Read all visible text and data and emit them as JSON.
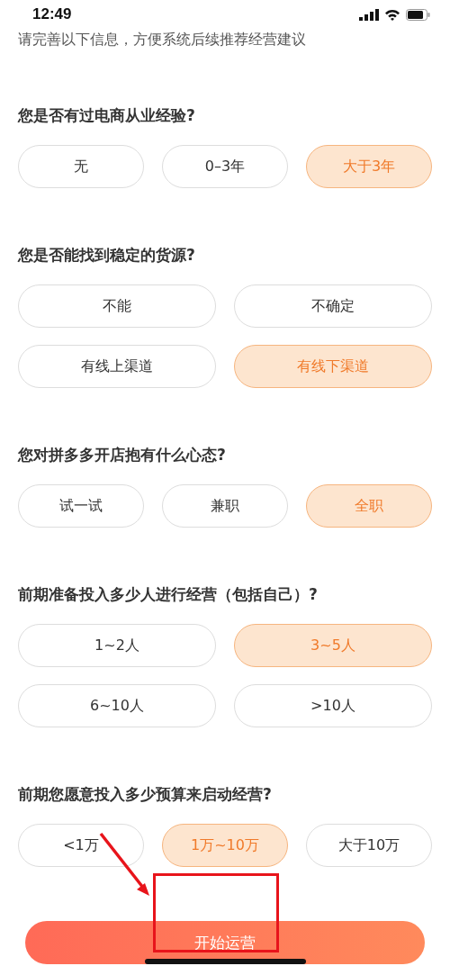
{
  "status_bar": {
    "time": "12:49"
  },
  "intro": "请完善以下信息，方便系统后续推荐经营建议",
  "questions": [
    {
      "title": "您是否有过电商从业经验?",
      "kind": "three",
      "options": [
        {
          "label": "无",
          "selected": false
        },
        {
          "label": "0–3年",
          "selected": false
        },
        {
          "label": "大于3年",
          "selected": true
        }
      ]
    },
    {
      "title": "您是否能找到稳定的货源?",
      "kind": "two",
      "options": [
        {
          "label": "不能",
          "selected": false
        },
        {
          "label": "不确定",
          "selected": false
        },
        {
          "label": "有线上渠道",
          "selected": false
        },
        {
          "label": "有线下渠道",
          "selected": true
        }
      ]
    },
    {
      "title": "您对拼多多开店抱有什么心态?",
      "kind": "three",
      "options": [
        {
          "label": "试一试",
          "selected": false
        },
        {
          "label": "兼职",
          "selected": false
        },
        {
          "label": "全职",
          "selected": true
        }
      ]
    },
    {
      "title": "前期准备投入多少人进行经营（包括自己）?",
      "kind": "two",
      "options": [
        {
          "label": "1~2人",
          "selected": false
        },
        {
          "label": "3~5人",
          "selected": true
        },
        {
          "label": "6~10人",
          "selected": false
        },
        {
          "label": ">10人",
          "selected": false
        }
      ]
    },
    {
      "title": "前期您愿意投入多少预算来启动经营?",
      "kind": "three",
      "options": [
        {
          "label": "<1万",
          "selected": false
        },
        {
          "label": "1万~10万",
          "selected": true
        },
        {
          "label": "大于10万",
          "selected": false
        }
      ]
    }
  ],
  "start_button": "开始运营"
}
